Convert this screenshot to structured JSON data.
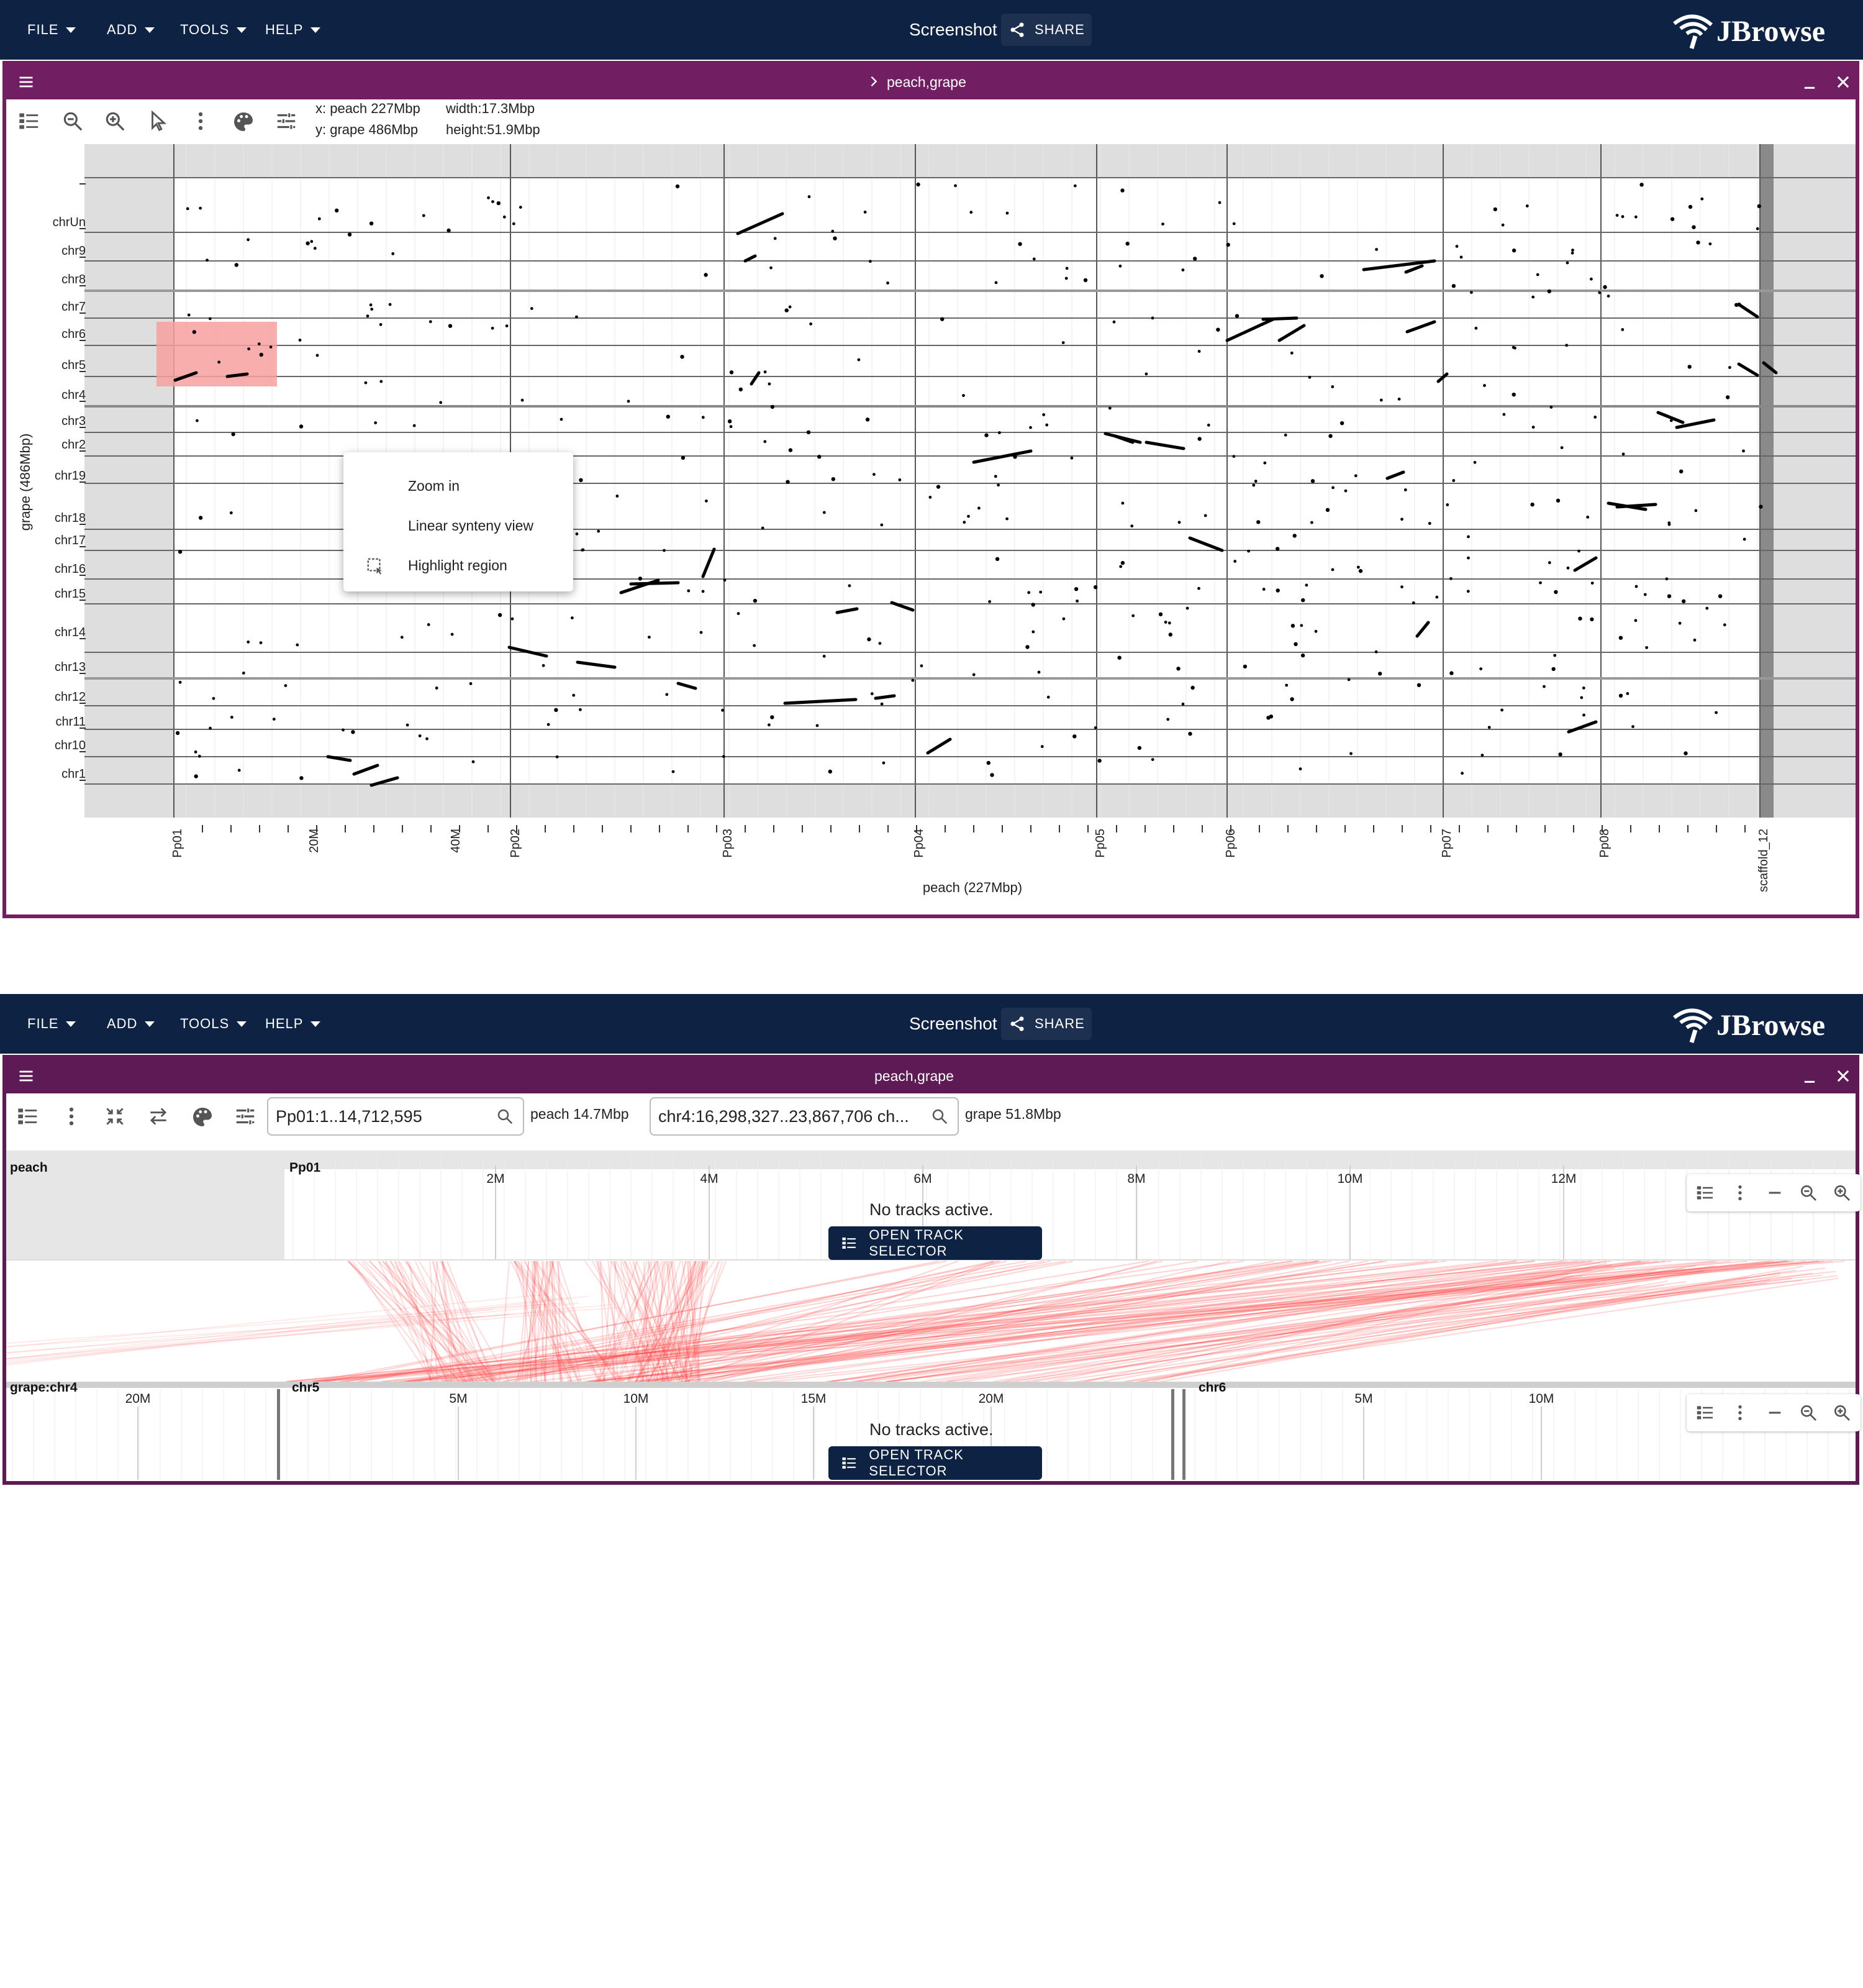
{
  "menu": {
    "file": "FILE",
    "add": "ADD",
    "tools": "TOOLS",
    "help": "HELP"
  },
  "header": {
    "session_title": "Screenshot",
    "share_label": "SHARE",
    "brand": "JBrowse"
  },
  "dotplot": {
    "title": "peach,grape",
    "coords": {
      "x": "x: peach 227Mbp",
      "y": "y: grape 486Mbp",
      "width": "width:17.3Mbp",
      "height": "height:51.9Mbp"
    },
    "y_axis_title": "grape (486Mbp)",
    "x_axis_title": "peach (227Mbp)",
    "y_labels": [
      "chrUn",
      "chr9",
      "chr8",
      "chr7",
      "chr6",
      "chr5",
      "chr4",
      "chr3",
      "chr2",
      "chr19",
      "chr18",
      "chr17",
      "chr16",
      "chr15",
      "chr14",
      "chr13",
      "chr12",
      "chr11",
      "chr10",
      "chr1"
    ],
    "x_labels": [
      "Pp01",
      "20M",
      "40M",
      "Pp02",
      "Pp03",
      "Pp04",
      "Pp05",
      "Pp06",
      "Pp07",
      "Pp08",
      "scaffold_12"
    ],
    "context_menu": {
      "zoom_in": "Zoom in",
      "linear_synteny": "Linear synteny view",
      "highlight": "Highlight region"
    },
    "highlight_color": "#f8a0a0"
  },
  "synteny": {
    "title": "peach,grape",
    "top_location": "Pp01:1..14,712,595",
    "top_span": "peach 14.7Mbp",
    "bottom_location": "chr4:16,298,327..23,867,706 ch...",
    "bottom_span": "grape 51.8Mbp",
    "top_track": {
      "assembly": "peach",
      "refname": "Pp01",
      "ticks": [
        "2M",
        "4M",
        "6M",
        "8M",
        "10M",
        "12M"
      ],
      "no_tracks": "No tracks active.",
      "button": "OPEN TRACK SELECTOR"
    },
    "bottom_track": {
      "assembly": "grape:chr4",
      "tick_chr4": "20M",
      "refname_chr5": "chr5",
      "ticks_chr5": [
        "5M",
        "10M",
        "15M",
        "20M"
      ],
      "refname_chr6": "chr6",
      "ticks_chr6": [
        "5M",
        "10M"
      ],
      "no_tracks": "No tracks active.",
      "button": "OPEN TRACK SELECTOR"
    },
    "synteny_color": "#ff3b3b"
  }
}
